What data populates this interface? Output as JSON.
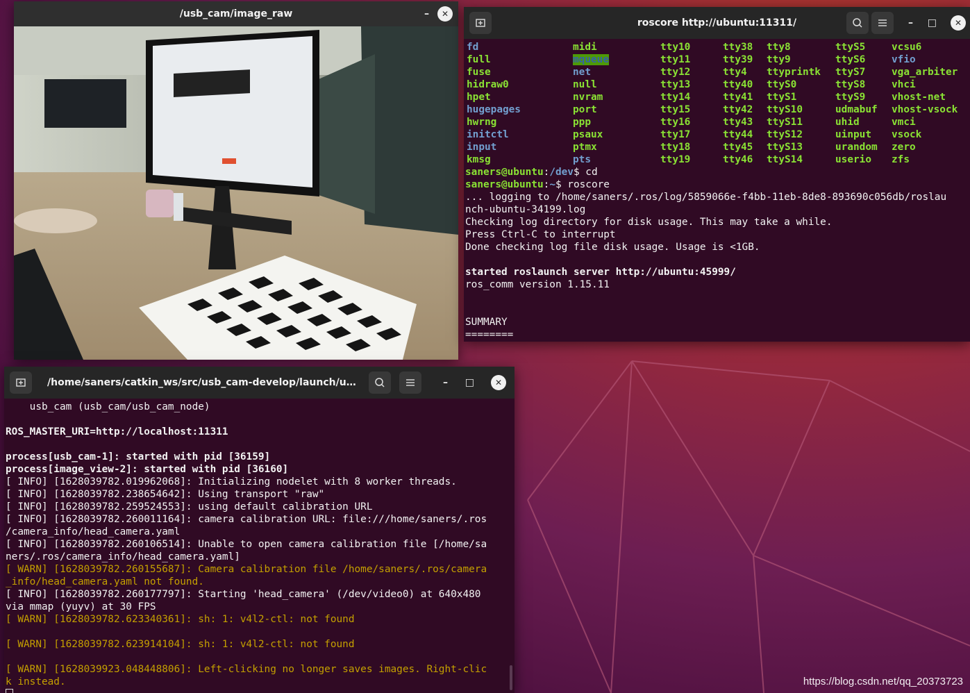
{
  "image_window": {
    "title": "/usb_cam/image_raw",
    "minimize": "–",
    "close": "✕"
  },
  "roscore_terminal": {
    "title": "roscore http://ubuntu:11311/",
    "new_tab_icon": "new-tab-icon",
    "search_icon": "search-icon",
    "menu_icon": "menu-icon",
    "devices": {
      "col1": [
        {
          "t": "fd",
          "c": "blue"
        },
        {
          "t": "full",
          "c": "green"
        },
        {
          "t": "fuse",
          "c": "green"
        },
        {
          "t": "hidraw0",
          "c": "green"
        },
        {
          "t": "hpet",
          "c": "green"
        },
        {
          "t": "hugepages",
          "c": "blue"
        },
        {
          "t": "hwrng",
          "c": "green"
        },
        {
          "t": "initctl",
          "c": "blue"
        },
        {
          "t": "input",
          "c": "blue"
        },
        {
          "t": "kmsg",
          "c": "green"
        }
      ],
      "col2": [
        {
          "t": "midi",
          "c": "green"
        },
        {
          "t": "mqueue",
          "c": "hl"
        },
        {
          "t": "net",
          "c": "blue"
        },
        {
          "t": "null",
          "c": "green"
        },
        {
          "t": "nvram",
          "c": "green"
        },
        {
          "t": "port",
          "c": "green"
        },
        {
          "t": "ppp",
          "c": "green"
        },
        {
          "t": "psaux",
          "c": "green"
        },
        {
          "t": "ptmx",
          "c": "green"
        },
        {
          "t": "pts",
          "c": "blue"
        }
      ],
      "col3": [
        {
          "t": "tty10",
          "c": "green"
        },
        {
          "t": "tty11",
          "c": "green"
        },
        {
          "t": "tty12",
          "c": "green"
        },
        {
          "t": "tty13",
          "c": "green"
        },
        {
          "t": "tty14",
          "c": "green"
        },
        {
          "t": "tty15",
          "c": "green"
        },
        {
          "t": "tty16",
          "c": "green"
        },
        {
          "t": "tty17",
          "c": "green"
        },
        {
          "t": "tty18",
          "c": "green"
        },
        {
          "t": "tty19",
          "c": "green"
        }
      ],
      "col4": [
        {
          "t": "tty38",
          "c": "green"
        },
        {
          "t": "tty39",
          "c": "green"
        },
        {
          "t": "tty4",
          "c": "green"
        },
        {
          "t": "tty40",
          "c": "green"
        },
        {
          "t": "tty41",
          "c": "green"
        },
        {
          "t": "tty42",
          "c": "green"
        },
        {
          "t": "tty43",
          "c": "green"
        },
        {
          "t": "tty44",
          "c": "green"
        },
        {
          "t": "tty45",
          "c": "green"
        },
        {
          "t": "tty46",
          "c": "green"
        }
      ],
      "col5": [
        {
          "t": "tty8",
          "c": "green"
        },
        {
          "t": "tty9",
          "c": "green"
        },
        {
          "t": "ttyprintk",
          "c": "green"
        },
        {
          "t": "ttyS0",
          "c": "green"
        },
        {
          "t": "ttyS1",
          "c": "green"
        },
        {
          "t": "ttyS10",
          "c": "green"
        },
        {
          "t": "ttyS11",
          "c": "green"
        },
        {
          "t": "ttyS12",
          "c": "green"
        },
        {
          "t": "ttyS13",
          "c": "green"
        },
        {
          "t": "ttyS14",
          "c": "green"
        }
      ],
      "col6": [
        {
          "t": "ttyS5",
          "c": "green"
        },
        {
          "t": "ttyS6",
          "c": "green"
        },
        {
          "t": "ttyS7",
          "c": "green"
        },
        {
          "t": "ttyS8",
          "c": "green"
        },
        {
          "t": "ttyS9",
          "c": "green"
        },
        {
          "t": "udmabuf",
          "c": "green"
        },
        {
          "t": "uhid",
          "c": "green"
        },
        {
          "t": "uinput",
          "c": "green"
        },
        {
          "t": "urandom",
          "c": "green"
        },
        {
          "t": "userio",
          "c": "green"
        }
      ],
      "col7": [
        {
          "t": "vcsu6",
          "c": "green"
        },
        {
          "t": "vfio",
          "c": "blue"
        },
        {
          "t": "vga_arbiter",
          "c": "green"
        },
        {
          "t": "vhci",
          "c": "green"
        },
        {
          "t": "vhost-net",
          "c": "green"
        },
        {
          "t": "vhost-vsock",
          "c": "green"
        },
        {
          "t": "vmci",
          "c": "green"
        },
        {
          "t": "vsock",
          "c": "green"
        },
        {
          "t": "zero",
          "c": "green"
        },
        {
          "t": "zfs",
          "c": "green"
        }
      ]
    },
    "prompt1": {
      "user": "saners@ubuntu",
      "sep": ":",
      "path": "/dev",
      "cmd": "$ cd"
    },
    "prompt2": {
      "user": "saners@ubuntu",
      "sep": ":",
      "path": "~",
      "cmd": "$ roscore"
    },
    "lines": [
      {
        "t": "... logging to /home/saners/.ros/log/5859066e-f4bb-11eb-8de8-893690c056db/roslau",
        "c": ""
      },
      {
        "t": "nch-ubuntu-34199.log",
        "c": ""
      },
      {
        "t": "Checking log directory for disk usage. This may take a while.",
        "c": ""
      },
      {
        "t": "Press Ctrl-C to interrupt",
        "c": ""
      },
      {
        "t": "Done checking log file disk usage. Usage is <1GB.",
        "c": ""
      },
      {
        "t": "",
        "c": ""
      },
      {
        "t": "started roslaunch server http://ubuntu:45999/",
        "c": "bold"
      },
      {
        "t": "ros_comm version 1.15.11",
        "c": ""
      },
      {
        "t": "",
        "c": ""
      },
      {
        "t": "",
        "c": ""
      },
      {
        "t": "SUMMARY",
        "c": ""
      },
      {
        "t": "========",
        "c": ""
      }
    ]
  },
  "usbcam_terminal": {
    "title": "/home/saners/catkin_ws/src/usb_cam-develop/launch/usb_c...",
    "lines": [
      {
        "t": "    usb_cam (usb_cam/usb_cam_node)",
        "c": ""
      },
      {
        "t": "",
        "c": ""
      },
      {
        "t": "ROS_MASTER_URI=http://localhost:11311",
        "c": "bold"
      },
      {
        "t": "",
        "c": ""
      },
      {
        "t": "process[usb_cam-1]: started with pid [36159]",
        "c": "bold"
      },
      {
        "t": "process[image_view-2]: started with pid [36160]",
        "c": "bold"
      },
      {
        "t": "[ INFO] [1628039782.019962068]: Initializing nodelet with 8 worker threads.",
        "c": ""
      },
      {
        "t": "[ INFO] [1628039782.238654642]: Using transport \"raw\"",
        "c": ""
      },
      {
        "t": "[ INFO] [1628039782.259524553]: using default calibration URL",
        "c": ""
      },
      {
        "t": "[ INFO] [1628039782.260011164]: camera calibration URL: file:///home/saners/.ros",
        "c": ""
      },
      {
        "t": "/camera_info/head_camera.yaml",
        "c": ""
      },
      {
        "t": "[ INFO] [1628039782.260106514]: Unable to open camera calibration file [/home/sa",
        "c": ""
      },
      {
        "t": "ners/.ros/camera_info/head_camera.yaml]",
        "c": ""
      },
      {
        "t": "[ WARN] [1628039782.260155687]: Camera calibration file /home/saners/.ros/camera",
        "c": "warn"
      },
      {
        "t": "_info/head_camera.yaml not found.",
        "c": "warn"
      },
      {
        "t": "[ INFO] [1628039782.260177797]: Starting 'head_camera' (/dev/video0) at 640x480",
        "c": ""
      },
      {
        "t": "via mmap (yuyv) at 30 FPS",
        "c": ""
      },
      {
        "t": "[ WARN] [1628039782.623340361]: sh: 1: v4l2-ctl: not found",
        "c": "warn"
      },
      {
        "t": "",
        "c": ""
      },
      {
        "t": "[ WARN] [1628039782.623914104]: sh: 1: v4l2-ctl: not found",
        "c": "warn"
      },
      {
        "t": "",
        "c": ""
      },
      {
        "t": "[ WARN] [1628039923.048448806]: Left-clicking no longer saves images. Right-clic",
        "c": "warn"
      },
      {
        "t": "k instead.",
        "c": "warn"
      }
    ]
  },
  "window_buttons": {
    "minimize": "–",
    "maximize": "□",
    "close": "✕"
  },
  "watermark": "https://blog.csdn.net/qq_20373723"
}
